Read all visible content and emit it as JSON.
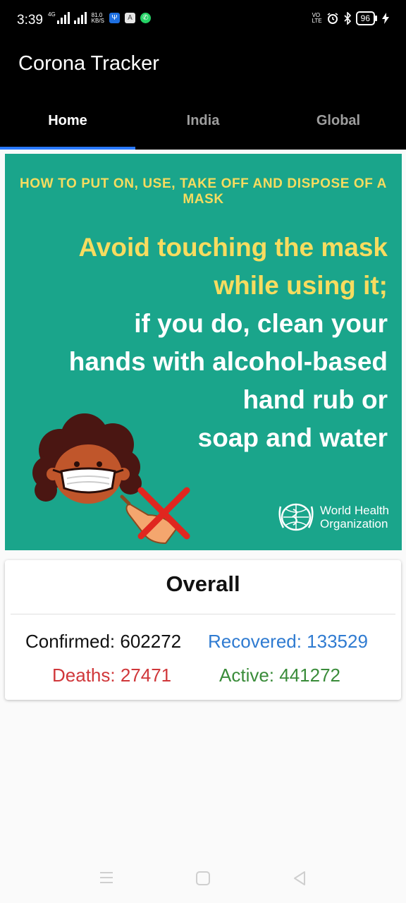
{
  "status_bar": {
    "time": "3:39",
    "net_tag": "4G",
    "speed": "81.0",
    "speed_unit": "KB/S",
    "volte_1": "VO",
    "volte_2": "LTE",
    "battery": "96",
    "icons": [
      "signal-icon",
      "usb-icon",
      "app-icon",
      "whatsapp-icon",
      "alarm-icon",
      "bluetooth-icon",
      "battery-icon",
      "charging-icon"
    ]
  },
  "app": {
    "title": "Corona Tracker"
  },
  "tabs": [
    {
      "label": "Home",
      "active": true
    },
    {
      "label": "India",
      "active": false
    },
    {
      "label": "Global",
      "active": false
    }
  ],
  "banner": {
    "heading": "HOW TO PUT ON, USE, TAKE OFF AND DISPOSE OF A MASK",
    "line1": "Avoid touching the mask",
    "line2": "while using it;",
    "line3": "if you do, clean your",
    "line4": "hands with alcohol-based",
    "line5": "hand rub or",
    "line6": "soap and water",
    "org_line1": "World Health",
    "org_line2": "Organization",
    "bg_color": "#1aa58b",
    "accent_color": "#f7dc5f"
  },
  "overall": {
    "title": "Overall",
    "confirmed": "Confirmed: 602272",
    "recovered": "Recovered: 133529",
    "deaths": "Deaths: 27471",
    "active": "Active: 441272",
    "colors": {
      "recovered": "#2f7bd1",
      "deaths": "#d0373a",
      "active": "#3a8c3a"
    }
  },
  "nav": {
    "icons": [
      "menu-icon",
      "home-icon",
      "back-icon"
    ]
  }
}
